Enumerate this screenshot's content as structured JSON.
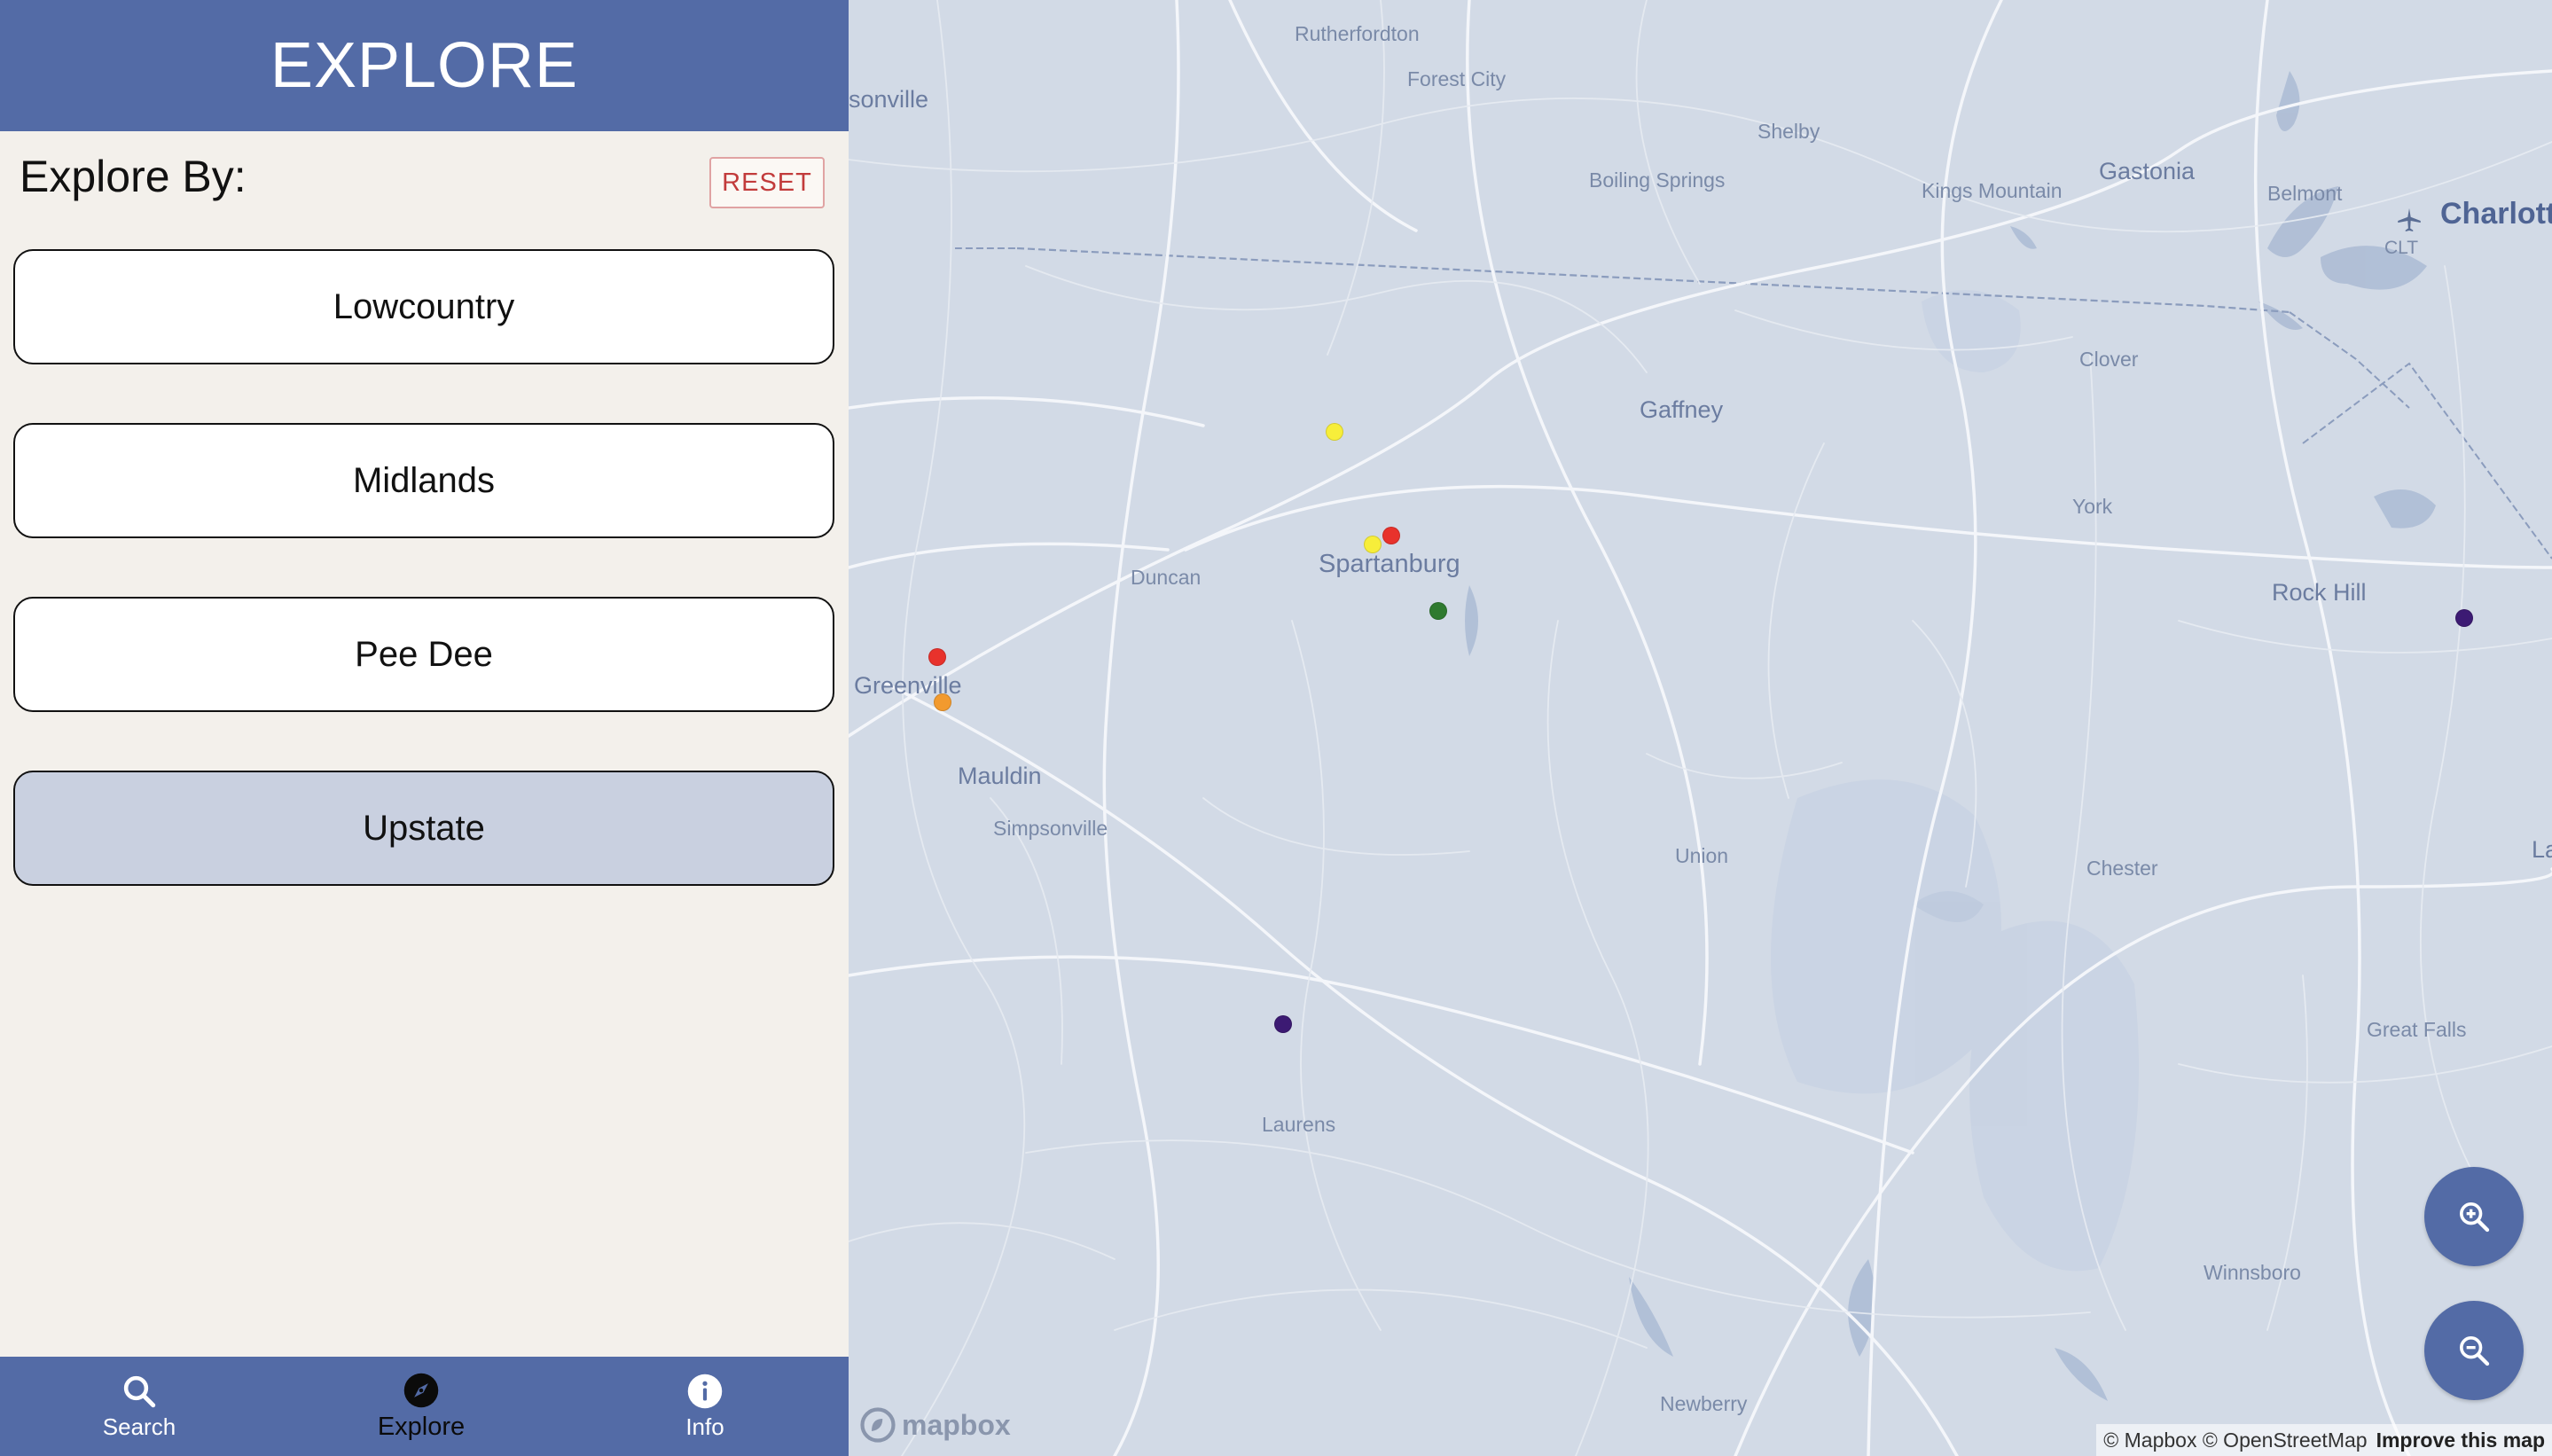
{
  "sidebar": {
    "title": "EXPLORE",
    "explore_by_label": "Explore By:",
    "reset_label": "RESET",
    "regions": [
      {
        "label": "Lowcountry",
        "selected": false
      },
      {
        "label": "Midlands",
        "selected": false
      },
      {
        "label": "Pee Dee",
        "selected": false
      },
      {
        "label": "Upstate",
        "selected": true
      }
    ]
  },
  "bottom_nav": {
    "items": [
      {
        "label": "Search",
        "icon": "search-icon",
        "active": false
      },
      {
        "label": "Explore",
        "icon": "compass-icon",
        "active": true
      },
      {
        "label": "Info",
        "icon": "info-icon",
        "active": false
      }
    ]
  },
  "map": {
    "labels": [
      {
        "text": "Rutherfordton"
      },
      {
        "text": "Forest City"
      },
      {
        "text": "Shelby"
      },
      {
        "text": "Gastonia"
      },
      {
        "text": "Boiling Springs"
      },
      {
        "text": "Kings Mountain"
      },
      {
        "text": "Belmont"
      },
      {
        "text": "Charlott"
      },
      {
        "text": "CLT"
      },
      {
        "text": "sonville"
      },
      {
        "text": "Clover"
      },
      {
        "text": "Gaffney"
      },
      {
        "text": "York"
      },
      {
        "text": "Spartanburg"
      },
      {
        "text": "Duncan"
      },
      {
        "text": "Rock Hill"
      },
      {
        "text": "Greenville"
      },
      {
        "text": "Mauldin"
      },
      {
        "text": "Simpsonville"
      },
      {
        "text": "Union"
      },
      {
        "text": "Chester"
      },
      {
        "text": "La"
      },
      {
        "text": "Great Falls"
      },
      {
        "text": "Laurens"
      },
      {
        "text": "Winnsboro"
      },
      {
        "text": "Newberry"
      }
    ],
    "markers": [
      {
        "color": "#f7ee3a",
        "name": "marker-yellow"
      },
      {
        "color": "#f7ee3a",
        "name": "marker-yellow"
      },
      {
        "color": "#e8322c",
        "name": "marker-red"
      },
      {
        "color": "#2f7a2f",
        "name": "marker-green"
      },
      {
        "color": "#e8322c",
        "name": "marker-red"
      },
      {
        "color": "#f29a2e",
        "name": "marker-orange"
      },
      {
        "color": "#3c1a73",
        "name": "marker-purple"
      },
      {
        "color": "#3c1a73",
        "name": "marker-purple"
      }
    ],
    "zoom_in_icon": "zoom-in-icon",
    "zoom_out_icon": "zoom-out-icon",
    "logo_text": "mapbox",
    "attribution": "© Mapbox © OpenStreetMap",
    "improve_link": "Improve this map"
  },
  "colors": {
    "header": "#536ba6",
    "sidebar_bg": "#f3f0eb",
    "selected_region": "#c9d0e0",
    "map_bg": "#d2dae6",
    "reset_text": "#c23b3b"
  }
}
